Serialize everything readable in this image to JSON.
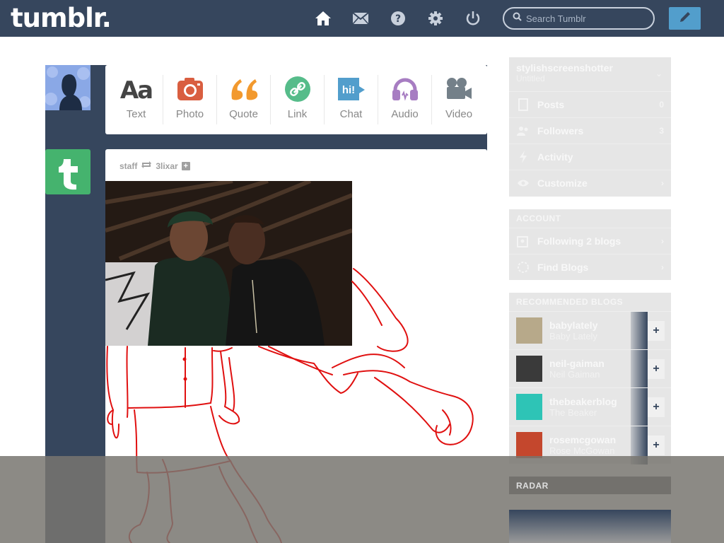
{
  "header": {
    "logo": "tumblr.",
    "search_placeholder": "Search Tumblr"
  },
  "post_types": [
    {
      "label": "Text",
      "icon": "text-icon",
      "color": "#444444"
    },
    {
      "label": "Photo",
      "icon": "camera-icon",
      "color": "#d95e40"
    },
    {
      "label": "Quote",
      "icon": "quote-icon",
      "color": "#f2992e"
    },
    {
      "label": "Link",
      "icon": "link-icon",
      "color": "#56bc8a"
    },
    {
      "label": "Chat",
      "icon": "chat-icon",
      "color": "#529ecc"
    },
    {
      "label": "Audio",
      "icon": "headphones-icon",
      "color": "#a77dc2"
    },
    {
      "label": "Video",
      "icon": "video-camera-icon",
      "color": "#748089"
    }
  ],
  "post": {
    "author": "staff",
    "reblogged_from": "3lixar"
  },
  "sidebar": {
    "blog_name": "stylishscreenshotter",
    "blog_title": "Untitled",
    "blog_items": [
      {
        "label": "Posts",
        "count": "0"
      },
      {
        "label": "Followers",
        "count": "3"
      },
      {
        "label": "Activity",
        "count": ""
      },
      {
        "label": "Customize",
        "count": ""
      }
    ],
    "account_heading": "ACCOUNT",
    "account_items": [
      {
        "label": "Following 2 blogs"
      },
      {
        "label": "Find Blogs"
      }
    ],
    "recommended_heading": "RECOMMENDED BLOGS",
    "recommended": [
      {
        "name": "babylately",
        "title": "Baby Lately",
        "thumb_color": "#b7a98a"
      },
      {
        "name": "neil-gaiman",
        "title": "Neil Gaiman",
        "thumb_color": "#3a3a3a"
      },
      {
        "name": "thebeakerblog",
        "title": "The Beaker",
        "thumb_color": "#2ec4b6"
      },
      {
        "name": "rosemcgowan",
        "title": "Rose McGowan",
        "thumb_color": "#c4472d"
      }
    ],
    "radar_heading": "RADAR"
  },
  "colors": {
    "navy": "#36465d",
    "accent_blue": "#529ecc",
    "sketch_red": "#e01010"
  }
}
